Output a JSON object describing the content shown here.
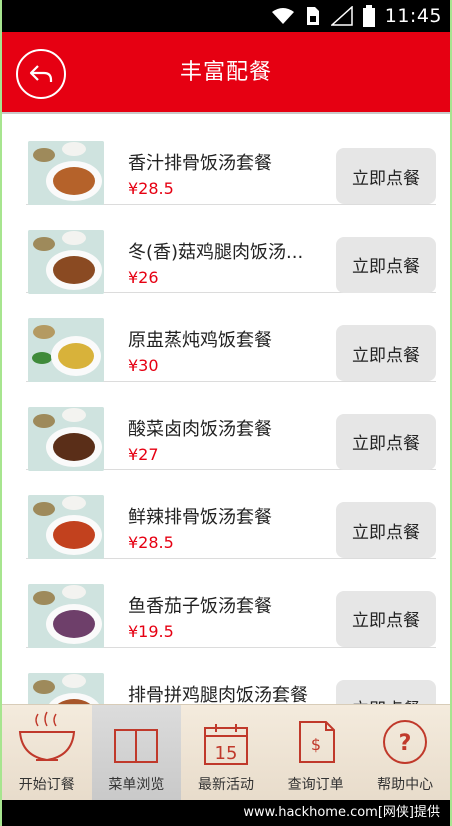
{
  "status_bar": {
    "time": "11:45"
  },
  "header": {
    "title": "丰富配餐"
  },
  "items": [
    {
      "name": "香汁排骨饭汤套餐",
      "price": "¥28.5",
      "button": "立即点餐"
    },
    {
      "name": "冬(香)菇鸡腿肉饭汤...",
      "price": "¥26",
      "button": "立即点餐"
    },
    {
      "name": "原盅蒸炖鸡饭套餐",
      "price": "¥30",
      "button": "立即点餐"
    },
    {
      "name": "酸菜卤肉饭汤套餐",
      "price": "¥27",
      "button": "立即点餐"
    },
    {
      "name": "鲜辣排骨饭汤套餐",
      "price": "¥28.5",
      "button": "立即点餐"
    },
    {
      "name": "鱼香茄子饭汤套餐",
      "price": "¥19.5",
      "button": "立即点餐"
    },
    {
      "name": "排骨拼鸡腿肉饭汤套餐",
      "price": "",
      "button": "立即点餐"
    }
  ],
  "tabbar": {
    "tabs": [
      {
        "label": "开始订餐",
        "icon": "bowl-icon"
      },
      {
        "label": "菜单浏览",
        "icon": "book-icon"
      },
      {
        "label": "最新活动",
        "icon": "calendar-icon",
        "calendar_day": "15"
      },
      {
        "label": "查询订单",
        "icon": "receipt-icon"
      },
      {
        "label": "帮助中心",
        "icon": "help-icon"
      }
    ],
    "active_index": 1
  },
  "watermark": "www.hackhome.com[网侠]提供",
  "colors": {
    "brand_red": "#e60012",
    "price_red": "#e60012",
    "button_gray": "#e6e6e6"
  }
}
